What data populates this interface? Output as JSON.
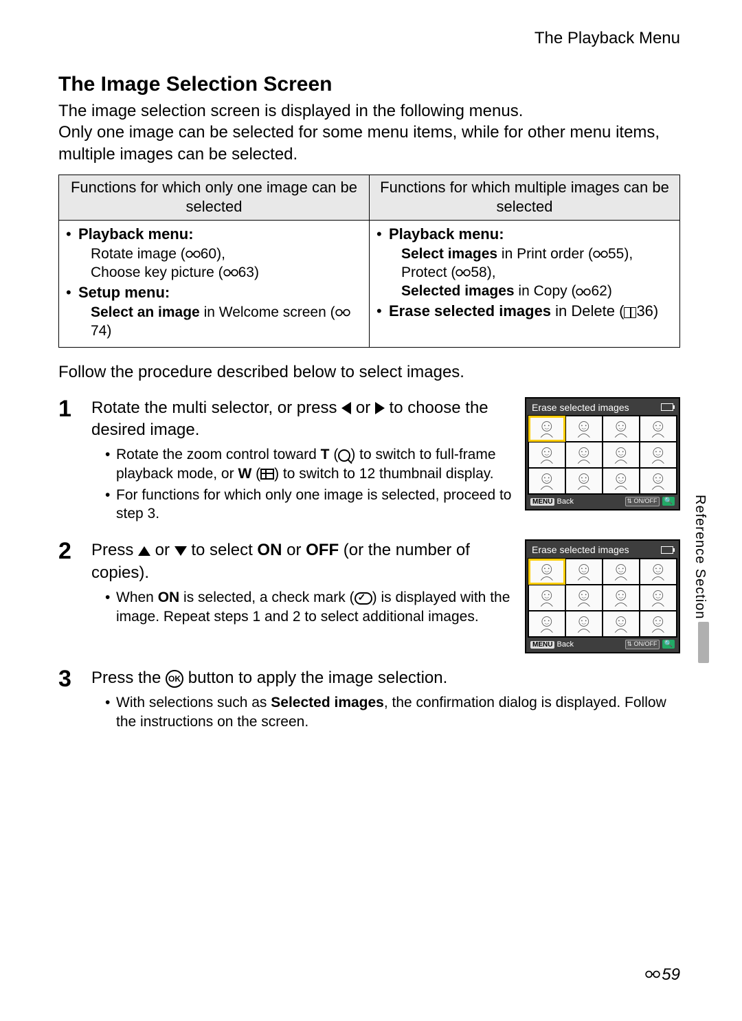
{
  "header": {
    "title": "The Playback Menu"
  },
  "heading": "The Image Selection Screen",
  "intro_line1": "The image selection screen is displayed in the following menus.",
  "intro_line2": "Only one image can be selected for some menu items, while for other menu items, multiple images can be selected.",
  "table": {
    "col1_header": "Functions for which only one image can be selected",
    "col2_header": "Functions for which multiple images can be selected",
    "left": {
      "playback_label": "Playback menu:",
      "rotate_pre": "Rotate image (",
      "rotate_ref": "60",
      "rotate_post": "),",
      "keypic_pre": "Choose key picture (",
      "keypic_ref": "63",
      "keypic_post": ")",
      "setup_label": "Setup menu:",
      "welcome_bold": "Select an image",
      "welcome_tail": " in Welcome screen (",
      "welcome_ref": "74",
      "welcome_post": ")"
    },
    "right": {
      "playback_label": "Playback menu:",
      "selimg_bold": "Select images",
      "selimg_tail": " in Print order (",
      "selimg_ref": "55",
      "selimg_post": "),",
      "protect_pre": "Protect (",
      "protect_ref": "58",
      "protect_post": "),",
      "selected_bold": "Selected images",
      "selected_tail": " in Copy (",
      "selected_ref": "62",
      "selected_post": ")",
      "erase_bold": "Erase selected images",
      "erase_tail": " in Delete (",
      "erase_ref": "36",
      "erase_post": ")"
    }
  },
  "follow": "Follow the procedure described below to select images.",
  "steps": {
    "s1": {
      "num": "1",
      "head_pre": "Rotate the multi selector, or press ",
      "head_mid": " or ",
      "head_post": " to choose the desired image.",
      "b1_pre": "Rotate the zoom control toward ",
      "b1_T": "T",
      "b1_t_post": " (",
      "b1_mid1": ") to switch to full-frame playback mode, or ",
      "b1_W": "W",
      "b1_w_post": " (",
      "b1_tail": ") to switch to 12 thumbnail display.",
      "b2": "For functions for which only one image is selected, proceed to step 3."
    },
    "s2": {
      "num": "2",
      "head_pre": "Press ",
      "head_mid": " or ",
      "head_seg": " to select ",
      "head_on": "ON",
      "head_or": " or ",
      "head_off": "OFF",
      "head_tail": " (or the number of copies).",
      "b1_pre": "When ",
      "b1_on": "ON",
      "b1_mid": " is selected, a check mark (",
      "b1_tail": ") is displayed with the image. Repeat steps 1 and 2 to select additional images."
    },
    "s3": {
      "num": "3",
      "head_pre": "Press the ",
      "head_post": " button to apply the image selection.",
      "b1_pre": "With selections such as ",
      "b1_bold": "Selected images",
      "b1_tail": ", the confirmation dialog is displayed. Follow the instructions on the screen."
    }
  },
  "lcd": {
    "title": "Erase selected images",
    "menu": "MENU",
    "back": "Back",
    "onoff": "ON/OFF"
  },
  "side": {
    "label": "Reference Section"
  },
  "page_number": "59",
  "ok_label": "OK"
}
